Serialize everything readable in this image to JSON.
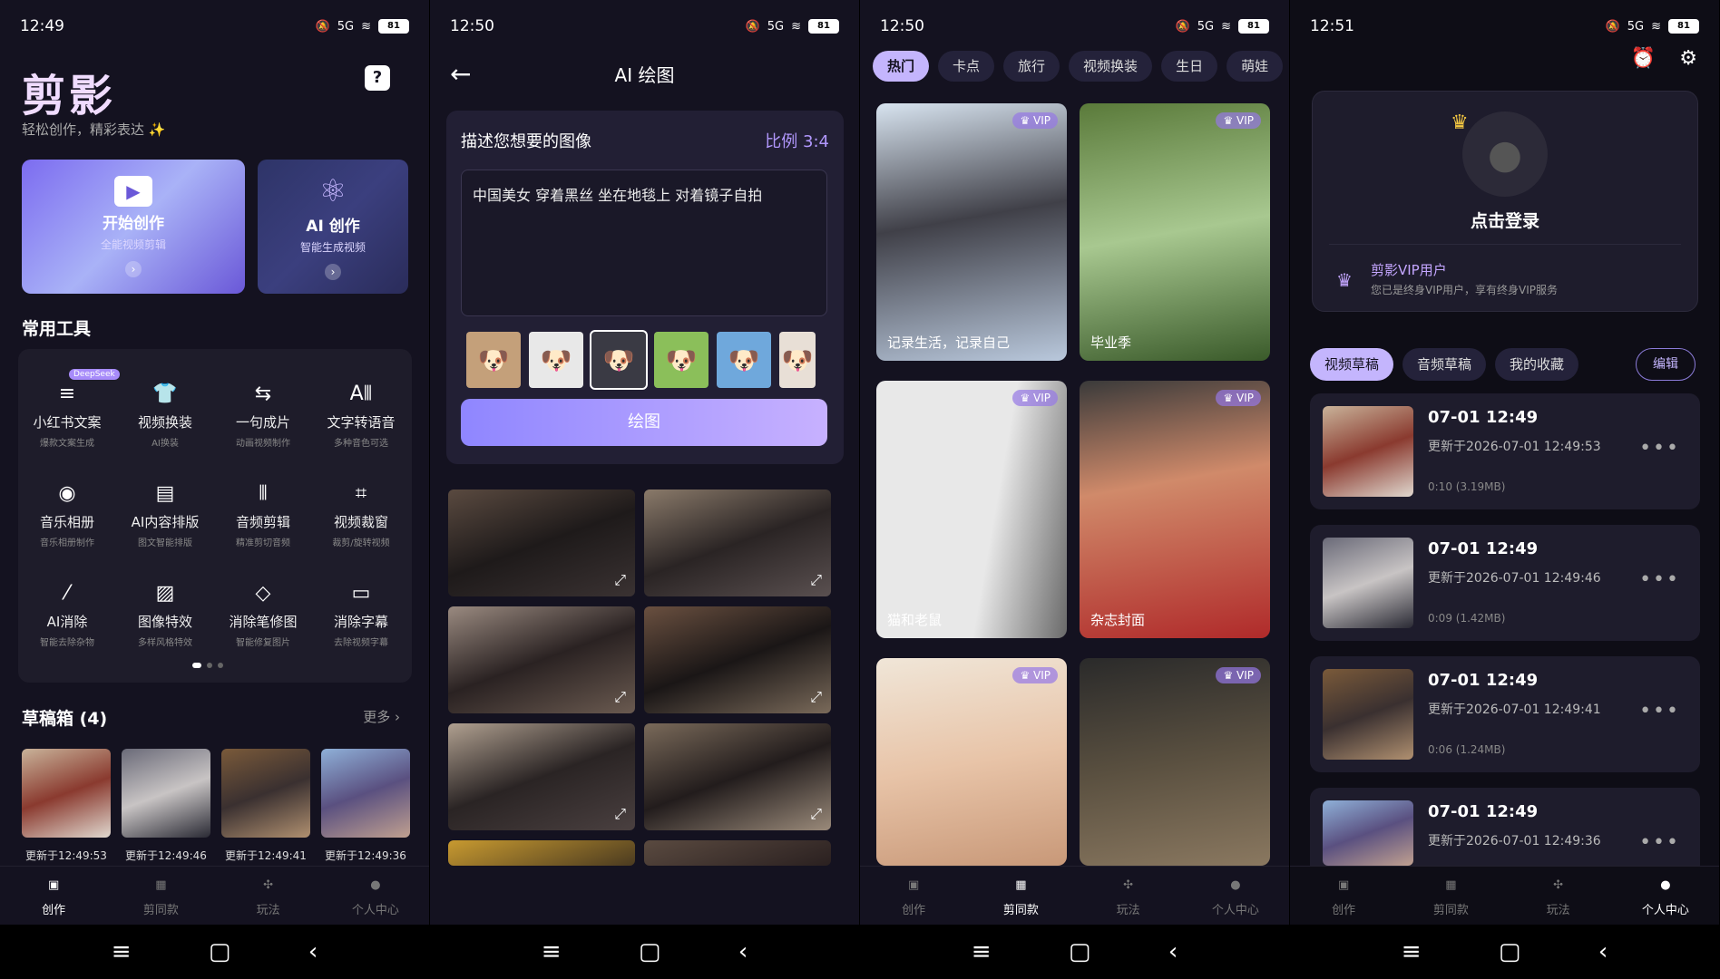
{
  "s1": {
    "status": {
      "time": "12:49",
      "signal": "5G",
      "battery": "81"
    },
    "logo": "剪影",
    "slogan": "轻松创作，精彩表达 ✨",
    "help": "?",
    "card1": {
      "title": "开始创作",
      "sub": "全能视频剪辑",
      "arrow": "›"
    },
    "card2": {
      "title": "AI 创作",
      "sub": "智能生成视频",
      "arrow": "›"
    },
    "tools_title": "常用工具",
    "tools": [
      {
        "name": "小红书文案",
        "desc": "爆款文案生成",
        "icon": "≡",
        "badge": "DeepSeek"
      },
      {
        "name": "视频换装",
        "desc": "AI换装",
        "icon": "👕"
      },
      {
        "name": "一句成片",
        "desc": "动画视频制作",
        "icon": "⇆"
      },
      {
        "name": "文字转语音",
        "desc": "多种音色可选",
        "icon": "A⦀"
      },
      {
        "name": "音乐相册",
        "desc": "音乐相册制作",
        "icon": "◉"
      },
      {
        "name": "AI内容排版",
        "desc": "图文智能排版",
        "icon": "▤"
      },
      {
        "name": "音频剪辑",
        "desc": "精准剪切音频",
        "icon": "⦀"
      },
      {
        "name": "视频裁窗",
        "desc": "裁剪/旋转视频",
        "icon": "⌗"
      },
      {
        "name": "AI消除",
        "desc": "智能去除杂物",
        "icon": "⁄"
      },
      {
        "name": "图像特效",
        "desc": "多样风格特效",
        "icon": "▨"
      },
      {
        "name": "消除笔修图",
        "desc": "智能修复图片",
        "icon": "◇"
      },
      {
        "name": "消除字幕",
        "desc": "去除视频字幕",
        "icon": "▭"
      }
    ],
    "drafts_title": "草稿箱 (4)",
    "more": "更多 ›",
    "drafts": [
      "更新于12:49:53",
      "更新于12:49:46",
      "更新于12:49:41",
      "更新于12:49:36"
    ]
  },
  "nav": [
    "创作",
    "剪同款",
    "玩法",
    "个人中心"
  ],
  "sysnav": [
    "≡",
    "▢",
    "‹"
  ],
  "s2": {
    "status": {
      "time": "12:50",
      "signal": "5G",
      "battery": "81"
    },
    "back": "←",
    "title": "AI 绘图",
    "panel_title": "描述您想要的图像",
    "ratio": "比例 3:4",
    "prompt": "中国美女 穿着黑丝 坐在地毯上 对着镜子自拍",
    "styles": [
      "🐶",
      "🐶",
      "🐶",
      "🐶",
      "🐶",
      "🐶"
    ],
    "draw": "绘图",
    "expand_icon": "⤢"
  },
  "s3": {
    "status": {
      "time": "12:50",
      "signal": "5G",
      "battery": "81"
    },
    "chips": [
      "热门",
      "卡点",
      "旅行",
      "视频换装",
      "生日",
      "萌娃"
    ],
    "vip": "♛ VIP",
    "cards": [
      "记录生活，记录自己",
      "毕业季",
      "猫和老鼠",
      "杂志封面",
      "",
      ""
    ]
  },
  "s4": {
    "status": {
      "time": "12:51",
      "signal": "5G",
      "battery": "81"
    },
    "login": "点击登录",
    "vip_title": "剪影VIP用户",
    "vip_sub": "您已是终身VIP用户，享有终身VIP服务",
    "tabs": [
      "视频草稿",
      "音频草稿",
      "我的收藏"
    ],
    "edit": "编辑",
    "drafts": [
      {
        "title": "07-01 12:49",
        "updated": "更新于2026-07-01 12:49:53",
        "size": "0:10 (3.19MB)"
      },
      {
        "title": "07-01 12:49",
        "updated": "更新于2026-07-01 12:49:46",
        "size": "0:09 (1.42MB)"
      },
      {
        "title": "07-01 12:49",
        "updated": "更新于2026-07-01 12:49:41",
        "size": "0:06 (1.24MB)"
      },
      {
        "title": "07-01 12:49",
        "updated": "更新于2026-07-01 12:49:36",
        "size": ""
      }
    ],
    "more": "•••"
  }
}
